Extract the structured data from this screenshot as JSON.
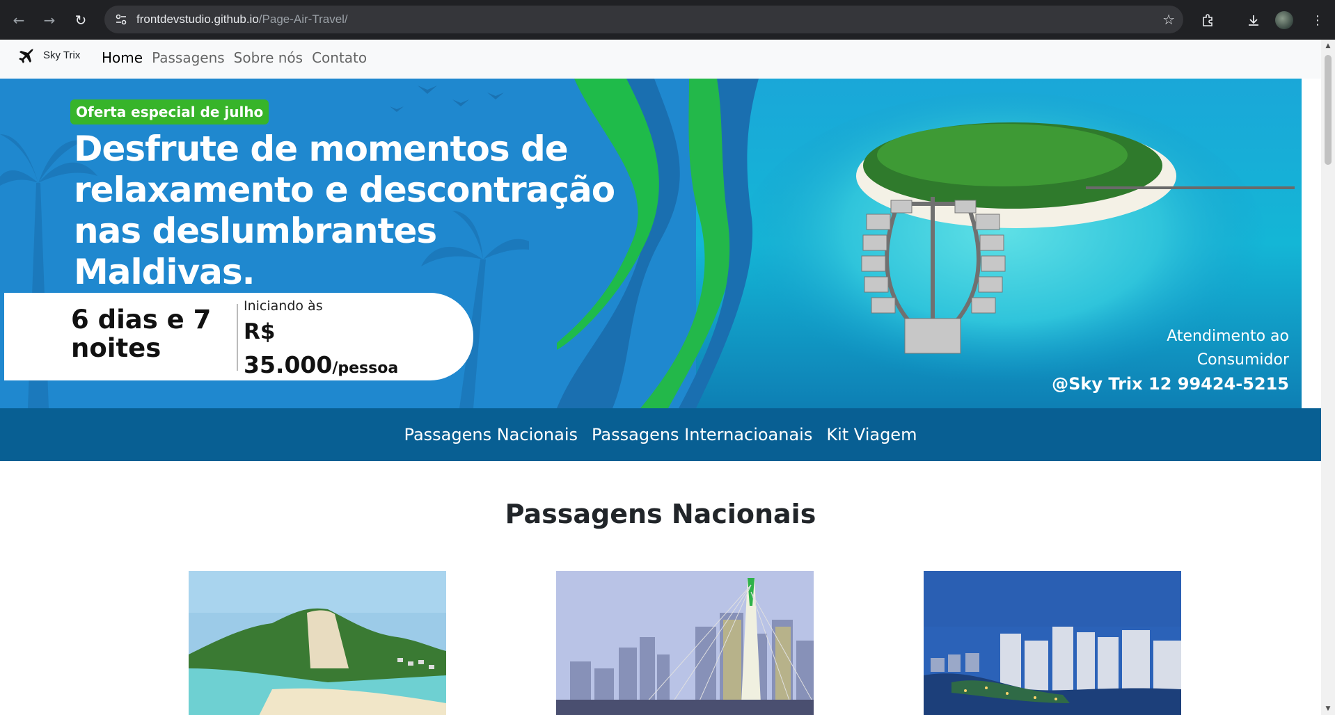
{
  "browser": {
    "url_host": "frontdevstudio.github.io",
    "url_path": "/Page-Air-Travel/",
    "icons": [
      "back-arrow-icon",
      "forward-arrow-icon",
      "reload-icon",
      "site-info-icon",
      "bookmark-star-icon",
      "extensions-icon",
      "download-icon",
      "profile-avatar",
      "more-menu-icon"
    ]
  },
  "navbar": {
    "brand": "Sky Trix",
    "links": [
      "Home",
      "Passagens",
      "Sobre nós",
      "Contato"
    ]
  },
  "hero": {
    "badge": "Oferta especial de julho",
    "title": "Desfrute de momentos de relaxamento e descontração nas deslumbrantes Maldivas.",
    "duration": "6 dias e 7 noites",
    "starting": "Iniciando às",
    "currency": "R$",
    "amount": "35.000",
    "per": "/pessoa",
    "contact_line1": "Atendimento ao",
    "contact_line2": "Consumidor",
    "contact_handle": "@Sky Trix 12 99424-5215"
  },
  "subnav": {
    "links": [
      "Passagens Nacionais",
      "Passagens Internacioanais",
      "Kit Viagem"
    ]
  },
  "section": {
    "title": "Passagens Nacionais"
  },
  "colors": {
    "hero_blue": "#1f88cf",
    "subnav_blue": "#085f93",
    "badge_green": "#37b42a"
  }
}
